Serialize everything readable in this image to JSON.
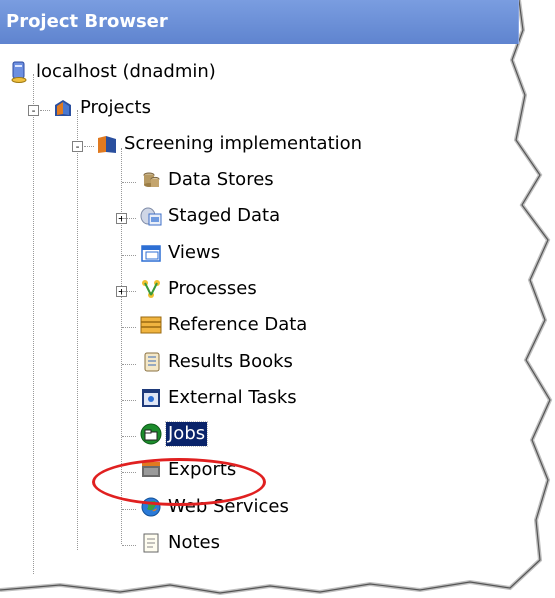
{
  "header": {
    "title": "Project Browser"
  },
  "tree": {
    "server": {
      "label": "localhost (dnadmin)",
      "icon": "server-icon"
    },
    "projects": {
      "label": "Projects",
      "icon": "projects-icon",
      "expander": "-"
    },
    "project": {
      "label": "Screening implementation",
      "icon": "project-book-icon",
      "expander": "-"
    },
    "items": [
      {
        "label": "Data Stores",
        "icon": "data-stores-icon"
      },
      {
        "label": "Staged Data",
        "icon": "staged-data-icon",
        "expander": "+"
      },
      {
        "label": "Views",
        "icon": "views-icon"
      },
      {
        "label": "Processes",
        "icon": "processes-icon",
        "expander": "+"
      },
      {
        "label": "Reference Data",
        "icon": "reference-data-icon"
      },
      {
        "label": "Results Books",
        "icon": "results-books-icon"
      },
      {
        "label": "External Tasks",
        "icon": "external-tasks-icon"
      },
      {
        "label": "Jobs",
        "icon": "jobs-icon",
        "selected": true
      },
      {
        "label": "Exports",
        "icon": "exports-icon"
      },
      {
        "label": "Web Services",
        "icon": "web-services-icon"
      },
      {
        "label": "Notes",
        "icon": "notes-icon"
      }
    ]
  },
  "colors": {
    "header": "#6b8fd6",
    "selection": "#0a246a",
    "annotation": "#e02020"
  }
}
